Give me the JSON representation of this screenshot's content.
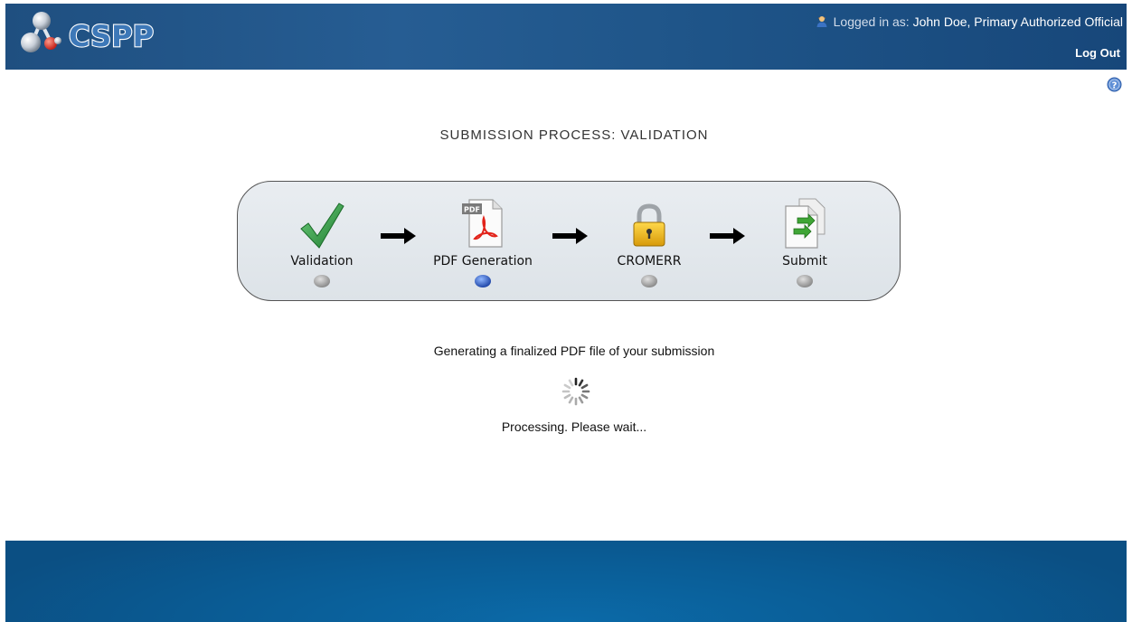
{
  "header": {
    "app_name": "CSPP",
    "logged_in_prefix": "Logged in as:",
    "user": "John Doe, Primary Authorized Official",
    "logout_label": "Log Out"
  },
  "page": {
    "title": "SUBMISSION PROCESS: VALIDATION"
  },
  "steps": [
    {
      "label": "Validation",
      "icon": "checkmark-icon",
      "state": "inactive"
    },
    {
      "label": "PDF Generation",
      "icon": "pdf-document-icon",
      "state": "active"
    },
    {
      "label": "CROMERR",
      "icon": "padlock-icon",
      "state": "inactive"
    },
    {
      "label": "Submit",
      "icon": "submit-document-icon",
      "state": "inactive"
    }
  ],
  "status": {
    "message": "Generating a finalized PDF file of your submission",
    "processing": "Processing. Please wait..."
  },
  "colors": {
    "header_bg": "#1f4f80",
    "footer_bg": "#0a5c95",
    "active_dot": "#2f5fbf",
    "inactive_dot": "#9a9a9a"
  }
}
